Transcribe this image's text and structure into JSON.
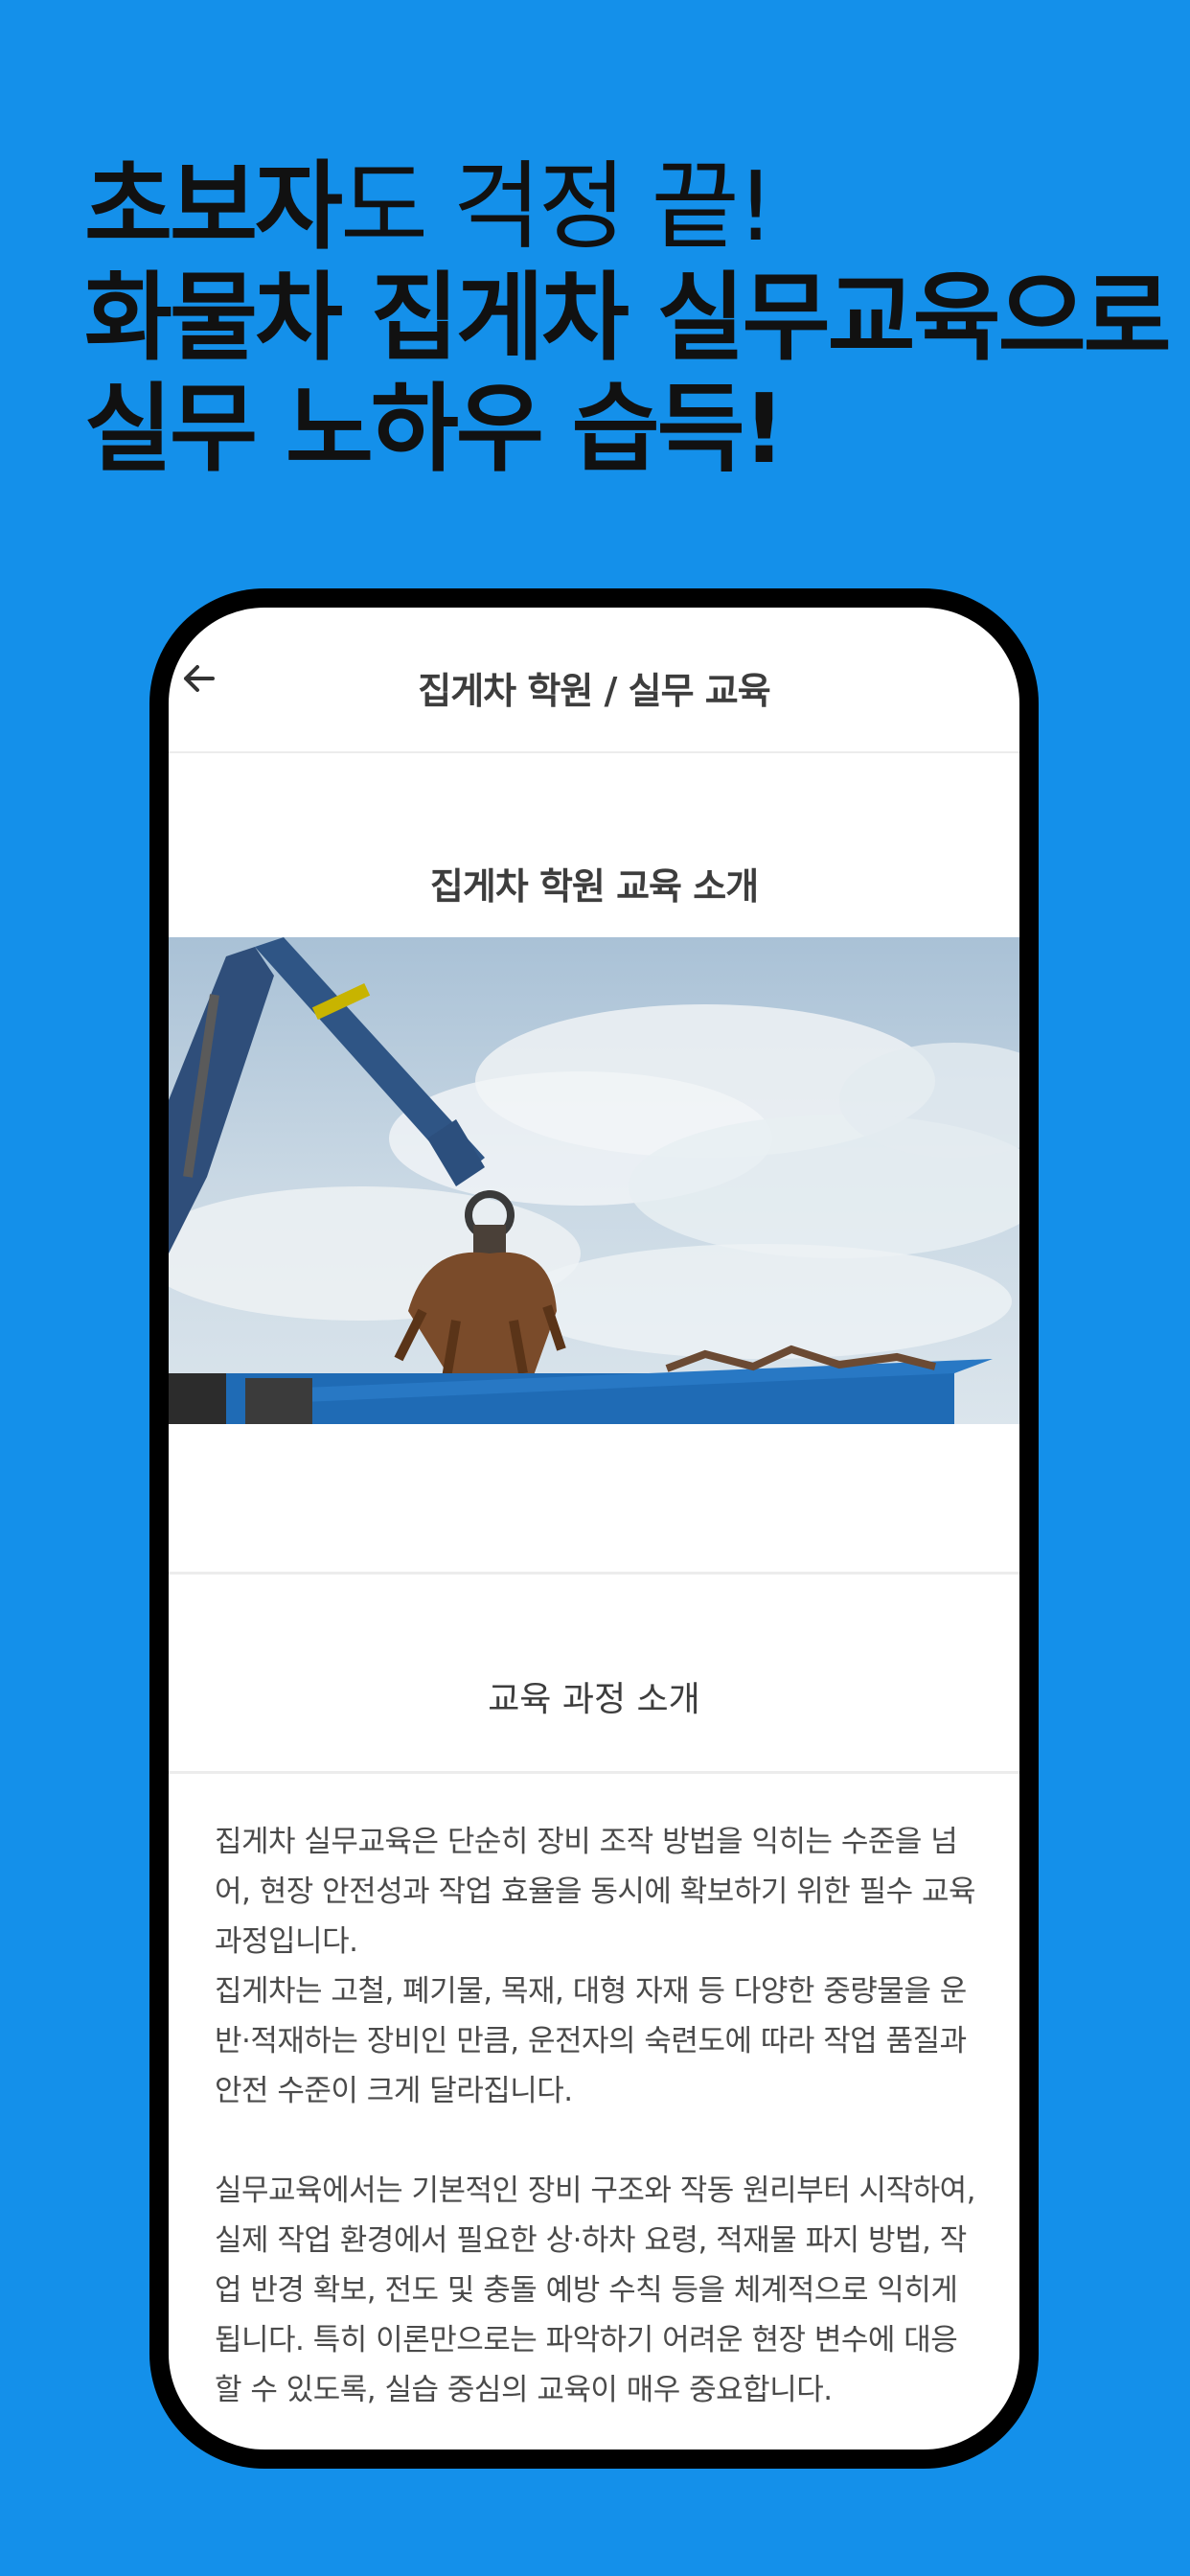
{
  "headline": {
    "line1_bold": "초보자",
    "line1_rest": "도 걱정 끝!",
    "line2": "화물차 집게차 실무교육으로",
    "line3": "실무 노하우 습득!"
  },
  "app": {
    "title": "집게차 학원 / 실무 교육",
    "back_icon": "arrow-left-icon",
    "section_title": "집게차 학원 교육 소개",
    "hero_image": "grapple-crane-scrap-container-photo",
    "course_title": "교육 과정 소개",
    "body": {
      "p1a": "집게차 실무교육은 단순히 장비 조작 방법을 익히는 수준을 넘어, 현장 안전성과 작업 효율을 동시에 확보하기 위한 필수 교육 과정입니다.",
      "p1b": "집게차는 고철, 폐기물, 목재, 대형 자재 등 다양한 중량물을 운반·적재하는 장비인 만큼, 운전자의 숙련도에 따라 작업 품질과 안전 수준이 크게 달라집니다.",
      "p2": "실무교육에서는 기본적인 장비 구조와 작동 원리부터 시작하여, 실제 작업 환경에서 필요한 상·하차 요령, 적재물 파지 방법, 작업 반경 확보, 전도 및 충돌 예방 수칙 등을 체계적으로 익히게 됩니다. 특히 이론만으로는 파악하기 어려운 현장 변수에 대응할 수 있도록, 실습 중심의 교육이 매우 중요합니다."
    }
  },
  "colors": {
    "background": "#1490EA",
    "headline_text": "#111111",
    "phone_frame": "#000000"
  }
}
